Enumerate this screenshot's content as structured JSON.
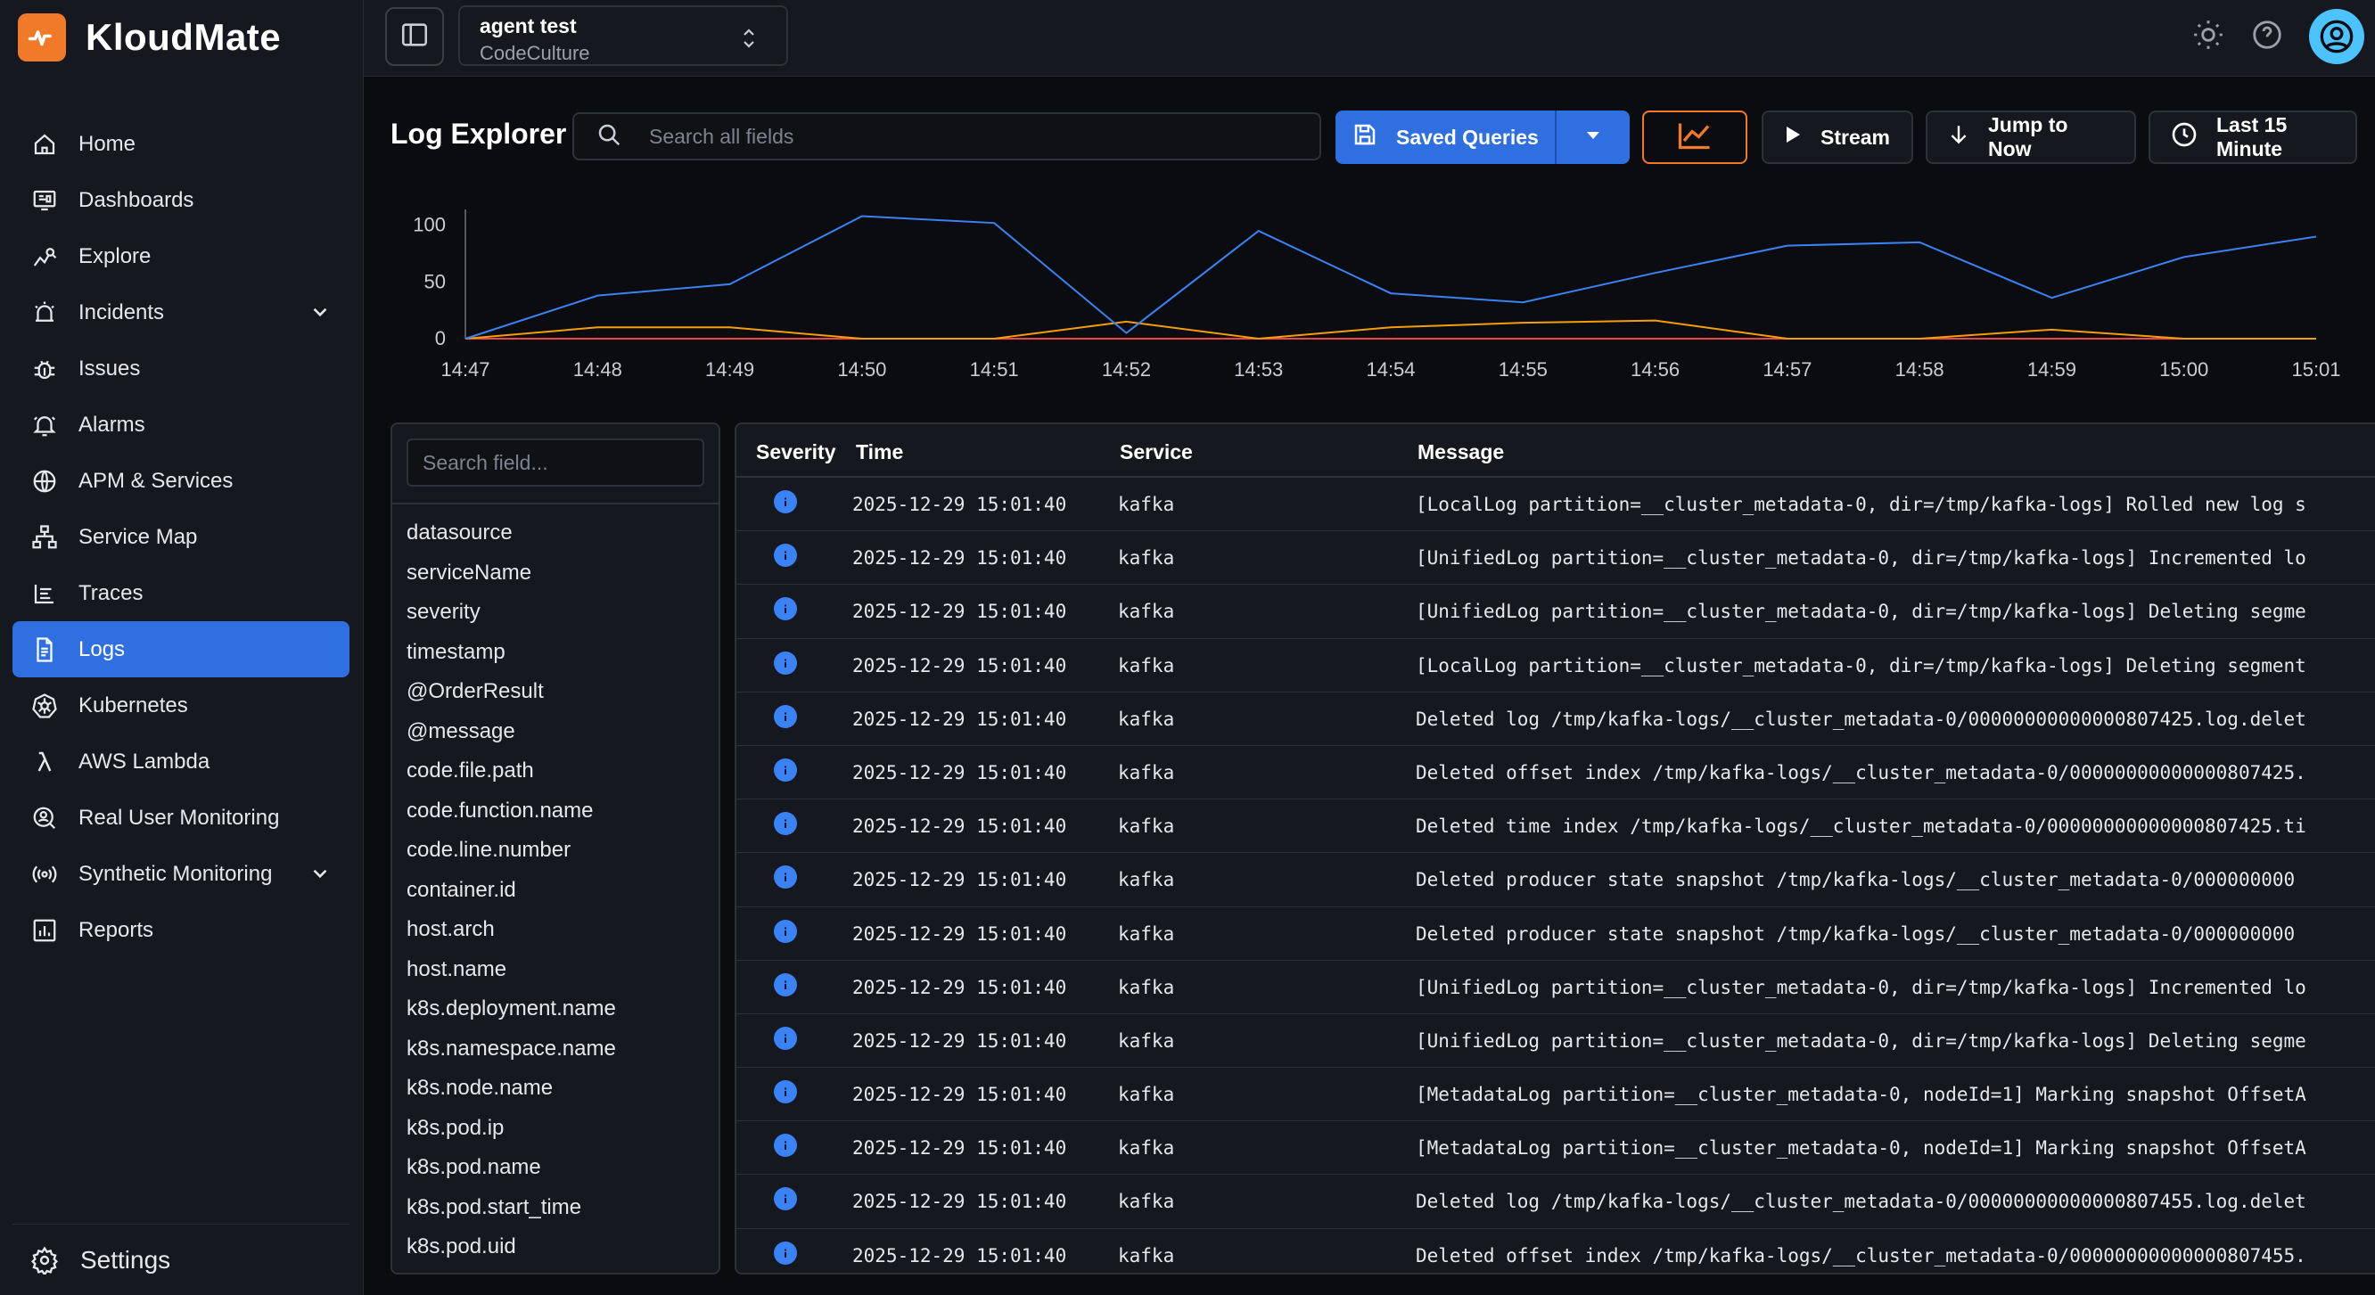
{
  "brand": {
    "name": "KloudMate"
  },
  "nav": {
    "items": [
      {
        "label": "Home",
        "icon": "home-icon"
      },
      {
        "label": "Dashboards",
        "icon": "dashboard-icon"
      },
      {
        "label": "Explore",
        "icon": "explore-icon"
      },
      {
        "label": "Incidents",
        "icon": "incident-icon"
      },
      {
        "label": "Issues",
        "icon": "bug-icon"
      },
      {
        "label": "Alarms",
        "icon": "bell-icon"
      },
      {
        "label": "APM & Services",
        "icon": "globe-icon"
      },
      {
        "label": "Service Map",
        "icon": "sitemap-icon"
      },
      {
        "label": "Traces",
        "icon": "traces-icon"
      },
      {
        "label": "Logs",
        "icon": "document-icon"
      },
      {
        "label": "Kubernetes",
        "icon": "helm-icon"
      },
      {
        "label": "AWS Lambda",
        "icon": "lambda-icon"
      },
      {
        "label": "Real User Monitoring",
        "icon": "rum-icon"
      },
      {
        "label": "Synthetic Monitoring",
        "icon": "broadcast-icon"
      },
      {
        "label": "Reports",
        "icon": "report-icon"
      }
    ],
    "settings_label": "Settings"
  },
  "topbar": {
    "workspace": "agent test",
    "org": "CodeCulture"
  },
  "toolbar": {
    "title": "Log Explorer",
    "search_placeholder": "Search all fields",
    "saved_queries_label": "Saved Queries",
    "stream_label": "Stream",
    "jump_label": "Jump to Now",
    "time_range_label": "Last 15 Minute"
  },
  "chart_data": {
    "type": "line",
    "x": [
      "14:47",
      "14:48",
      "14:49",
      "14:50",
      "14:51",
      "14:52",
      "14:53",
      "14:54",
      "14:55",
      "14:56",
      "14:57",
      "14:58",
      "14:59",
      "15:00",
      "15:01"
    ],
    "yticks": [
      0,
      50,
      100
    ],
    "ylim": [
      0,
      110
    ],
    "series": [
      {
        "color": "#3b82f6",
        "values": [
          0,
          38,
          48,
          108,
          102,
          5,
          95,
          40,
          32,
          58,
          82,
          85,
          36,
          72,
          90
        ]
      },
      {
        "color": "#f59e0b",
        "values": [
          0,
          10,
          10,
          0,
          0,
          15,
          0,
          10,
          14,
          16,
          0,
          0,
          8,
          0,
          0
        ]
      },
      {
        "color": "#ef4444",
        "values": [
          0,
          0,
          0,
          0,
          0,
          0,
          0,
          0,
          0,
          0,
          0,
          0,
          0,
          0,
          0
        ]
      }
    ]
  },
  "fields": {
    "search_placeholder": "Search field...",
    "items": [
      "datasource",
      "serviceName",
      "severity",
      "timestamp",
      "@OrderResult",
      "@message",
      "code.file.path",
      "code.function.name",
      "code.line.number",
      "container.id",
      "host.arch",
      "host.name",
      "k8s.deployment.name",
      "k8s.namespace.name",
      "k8s.node.name",
      "k8s.pod.ip",
      "k8s.pod.name",
      "k8s.pod.start_time",
      "k8s.pod.uid"
    ]
  },
  "table": {
    "columns": [
      "Severity",
      "Time",
      "Service",
      "Message"
    ],
    "rows": [
      {
        "time": "2025-12-29 15:01:40",
        "service": "kafka",
        "message": "[LocalLog partition=__cluster_metadata-0, dir=/tmp/kafka-logs] Rolled new log s"
      },
      {
        "time": "2025-12-29 15:01:40",
        "service": "kafka",
        "message": "[UnifiedLog partition=__cluster_metadata-0, dir=/tmp/kafka-logs] Incremented lo"
      },
      {
        "time": "2025-12-29 15:01:40",
        "service": "kafka",
        "message": "[UnifiedLog partition=__cluster_metadata-0, dir=/tmp/kafka-logs] Deleting segme"
      },
      {
        "time": "2025-12-29 15:01:40",
        "service": "kafka",
        "message": "[LocalLog partition=__cluster_metadata-0, dir=/tmp/kafka-logs] Deleting segment"
      },
      {
        "time": "2025-12-29 15:01:40",
        "service": "kafka",
        "message": "Deleted log /tmp/kafka-logs/__cluster_metadata-0/00000000000000807425.log.delet"
      },
      {
        "time": "2025-12-29 15:01:40",
        "service": "kafka",
        "message": "Deleted offset index /tmp/kafka-logs/__cluster_metadata-0/00000000000000807425."
      },
      {
        "time": "2025-12-29 15:01:40",
        "service": "kafka",
        "message": "Deleted time index /tmp/kafka-logs/__cluster_metadata-0/00000000000000807425.ti"
      },
      {
        "time": "2025-12-29 15:01:40",
        "service": "kafka",
        "message": "Deleted producer state snapshot /tmp/kafka-logs/__cluster_metadata-0/000000000"
      },
      {
        "time": "2025-12-29 15:01:40",
        "service": "kafka",
        "message": "Deleted producer state snapshot /tmp/kafka-logs/__cluster_metadata-0/000000000"
      },
      {
        "time": "2025-12-29 15:01:40",
        "service": "kafka",
        "message": "[UnifiedLog partition=__cluster_metadata-0, dir=/tmp/kafka-logs] Incremented lo"
      },
      {
        "time": "2025-12-29 15:01:40",
        "service": "kafka",
        "message": "[UnifiedLog partition=__cluster_metadata-0, dir=/tmp/kafka-logs] Deleting segme"
      },
      {
        "time": "2025-12-29 15:01:40",
        "service": "kafka",
        "message": "[MetadataLog partition=__cluster_metadata-0, nodeId=1] Marking snapshot OffsetA"
      },
      {
        "time": "2025-12-29 15:01:40",
        "service": "kafka",
        "message": "[MetadataLog partition=__cluster_metadata-0, nodeId=1] Marking snapshot OffsetA"
      },
      {
        "time": "2025-12-29 15:01:40",
        "service": "kafka",
        "message": "Deleted log /tmp/kafka-logs/__cluster_metadata-0/00000000000000807455.log.delet"
      },
      {
        "time": "2025-12-29 15:01:40",
        "service": "kafka",
        "message": "Deleted offset index /tmp/kafka-logs/__cluster_metadata-0/00000000000000807455."
      }
    ]
  },
  "colors": {
    "accent": "#2f6fe0",
    "brand": "#f07a2a",
    "info": "#3b82f6"
  }
}
